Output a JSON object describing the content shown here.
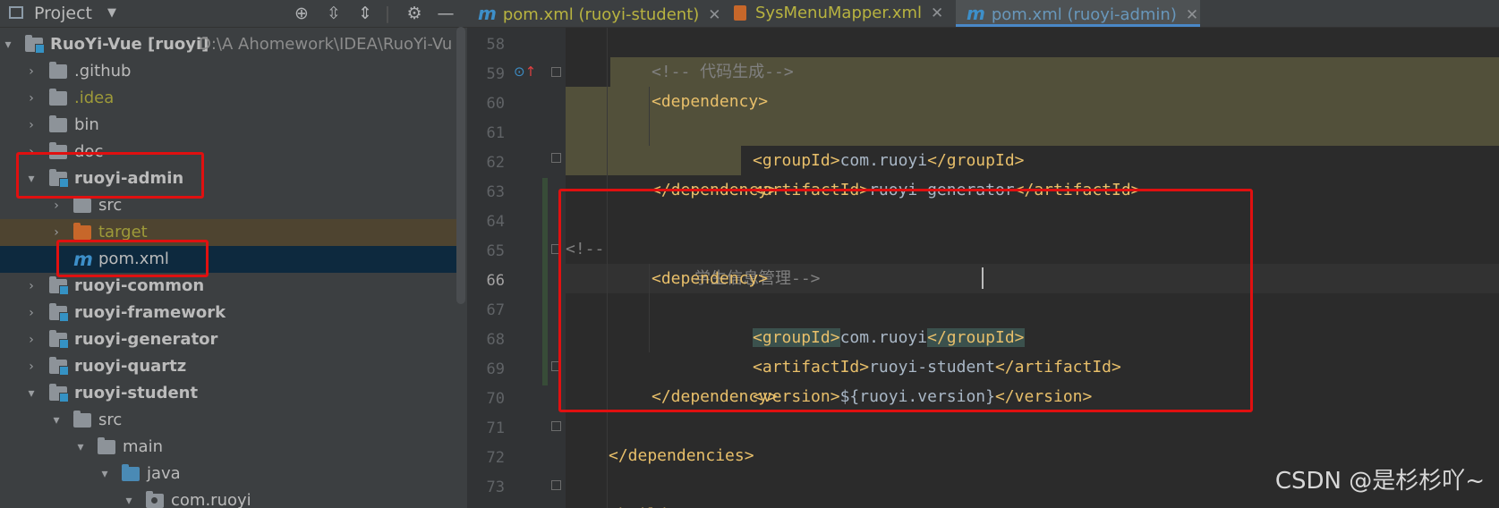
{
  "project_panel": {
    "title": "Project",
    "header_icons": [
      "crosshair-icon",
      "expand-all-icon",
      "collapse-all-icon",
      "gear-icon",
      "minimize-icon"
    ],
    "root": {
      "name": "RuoYi-Vue [ruoyi]",
      "path": "D:\\A Ahomework\\IDEA\\RuoYi-Vu"
    },
    "items": [
      {
        "label": ".github"
      },
      {
        "label": ".idea"
      },
      {
        "label": "bin"
      },
      {
        "label": "doc"
      },
      {
        "label": "ruoyi-admin"
      },
      {
        "label": "src"
      },
      {
        "label": "target"
      },
      {
        "label": "pom.xml"
      },
      {
        "label": "ruoyi-common"
      },
      {
        "label": "ruoyi-framework"
      },
      {
        "label": "ruoyi-generator"
      },
      {
        "label": "ruoyi-quartz"
      },
      {
        "label": "ruoyi-student"
      },
      {
        "label": "src"
      },
      {
        "label": "main"
      },
      {
        "label": "java"
      },
      {
        "label": "com.ruoyi"
      }
    ]
  },
  "tabs": [
    {
      "label": "pom.xml (ruoyi-student)"
    },
    {
      "label": "SysMenuMapper.xml"
    },
    {
      "label": "pom.xml (ruoyi-admin)"
    }
  ],
  "editor": {
    "line_numbers": [
      "58",
      "59",
      "60",
      "61",
      "62",
      "63",
      "64",
      "65",
      "66",
      "67",
      "68",
      "69",
      "70",
      "71",
      "72",
      "73"
    ],
    "lines": {
      "l58": "<!-- 代码生成-->",
      "l59": "<dependency>",
      "l60_open": "<groupId>",
      "l60_val": "com.ruoyi",
      "l60_close": "</groupId>",
      "l61_open": "<artifactId>",
      "l61_val": "ruoyi-generator",
      "l61_close": "</artifactId>",
      "l62": "</dependency>",
      "l64_a": "<!--",
      "l64_b": "学生信息管理-->",
      "l65": "<dependency>",
      "l66_open": "<groupId>",
      "l66_val": "com.ruoyi",
      "l66_close": "</groupId>",
      "l67_open": "<artifactId>",
      "l67_val": "ruoyi-student",
      "l67_close": "</artifactId>",
      "l68_open": "<version>",
      "l68_val": "${ruoyi.version}",
      "l68_close": "</version>",
      "l69": "</dependency>",
      "l71": "</dependencies>",
      "l73": "<build>"
    }
  },
  "colors": {
    "panel_bg": "#3c3f41",
    "editor_bg": "#2b2b2b",
    "tag": "#e8bf6a",
    "text": "#a9b7c6",
    "comment": "#808080",
    "annotation_red": "#e01010",
    "selection": "#0d293e"
  },
  "watermark": "CSDN @是杉杉吖~"
}
